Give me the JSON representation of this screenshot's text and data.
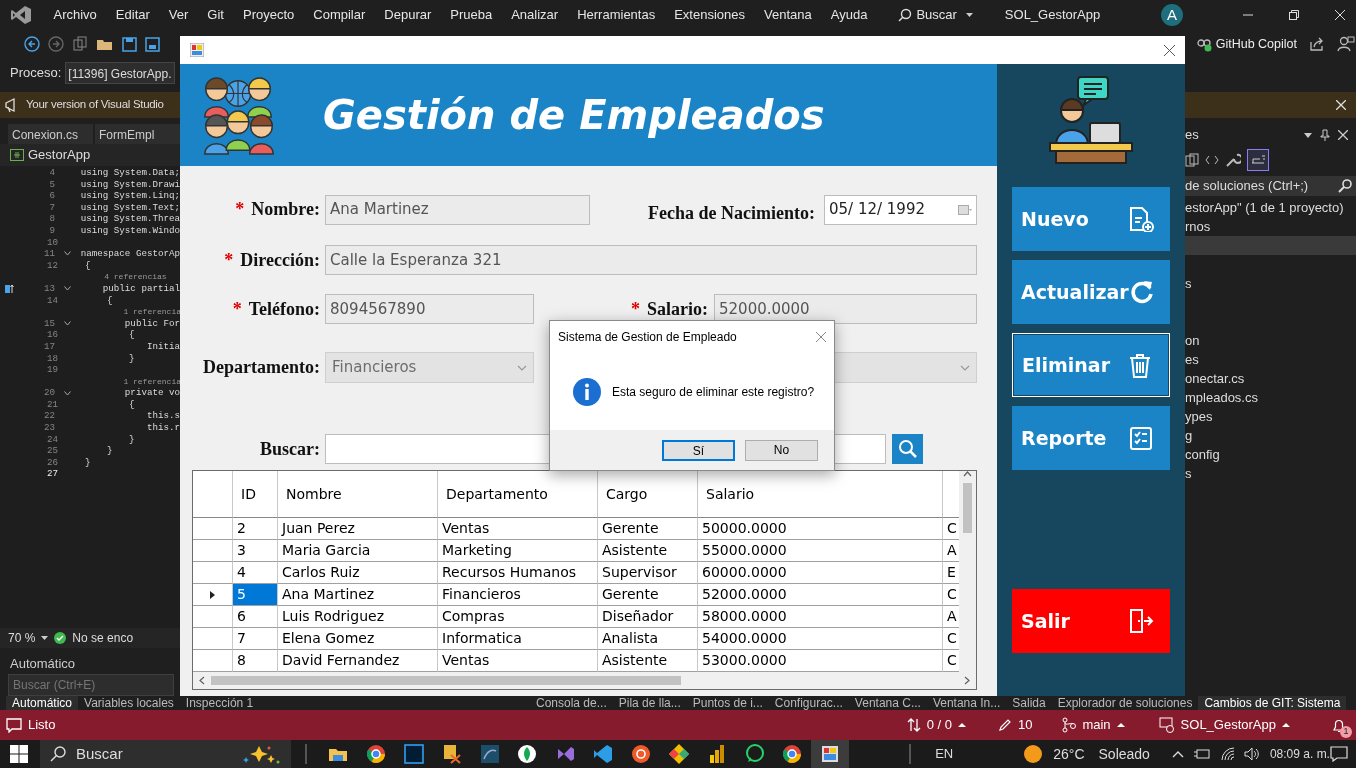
{
  "ide": {
    "menu": [
      "Archivo",
      "Editar",
      "Ver",
      "Git",
      "Proyecto",
      "Compilar",
      "Depurar",
      "Prueba",
      "Analizar",
      "Herramientas",
      "Extensiones",
      "Ventana",
      "Ayuda"
    ],
    "search": "Buscar",
    "solution_name": "SOL_GestorApp",
    "account_initial": "A",
    "copilot": "GitHub Copilot",
    "process_label": "Proceso:",
    "process_value": "[11396] GestorApp.",
    "notification": "Your version of Visual Studio",
    "editor_tabs": [
      "Conexion.cs",
      "FormEmpl"
    ],
    "project_dropdown": "GestorApp",
    "code_lines": [
      {
        "kind": "code",
        "number": "4",
        "text": "using System.Data;"
      },
      {
        "kind": "code",
        "number": "5",
        "text": "using System.Drawi"
      },
      {
        "kind": "code",
        "number": "6",
        "text": "using System.Linq;"
      },
      {
        "kind": "code",
        "number": "7",
        "text": "using System.Text;"
      },
      {
        "kind": "code",
        "number": "8",
        "text": "using System.Threa"
      },
      {
        "kind": "code",
        "number": "9",
        "text": "using System.Windo"
      },
      {
        "kind": "code",
        "number": "10"
      },
      {
        "kind": "code",
        "number": "11",
        "text": "namespace GestorAp",
        "foldable": true
      },
      {
        "kind": "code",
        "number": "12",
        "text": "{"
      },
      {
        "kind": "lens",
        "text": "    4 referencias"
      },
      {
        "kind": "code",
        "number": "13",
        "text": "    public partial",
        "foldable": true,
        "marker": true
      },
      {
        "kind": "code",
        "number": "14",
        "text": "    {"
      },
      {
        "kind": "lens",
        "text": "        1 referencia"
      },
      {
        "kind": "code",
        "number": "15",
        "text": "        public For",
        "foldable": true
      },
      {
        "kind": "code",
        "number": "16",
        "text": "        {"
      },
      {
        "kind": "code",
        "number": "17",
        "text": "            Initia"
      },
      {
        "kind": "code",
        "number": "18",
        "text": "        }"
      },
      {
        "kind": "code",
        "number": "19"
      },
      {
        "kind": "lens",
        "text": "        1 referencia"
      },
      {
        "kind": "code",
        "number": "20",
        "text": "        private vo",
        "foldable": true
      },
      {
        "kind": "code",
        "number": "21",
        "text": "        {"
      },
      {
        "kind": "code",
        "number": "22",
        "text": "            this.s"
      },
      {
        "kind": "code",
        "number": "23",
        "text": "            this.r"
      },
      {
        "kind": "code",
        "number": "24",
        "text": "        }"
      },
      {
        "kind": "code",
        "number": "25",
        "text": "    }"
      },
      {
        "kind": "code",
        "number": "26",
        "text": "}"
      },
      {
        "kind": "code",
        "number": "27",
        "current": true
      }
    ],
    "zoom": "70 %",
    "issues": "No se enco",
    "auto_panel": {
      "title": "Automático",
      "search_placeholder": "Buscar (Ctrl+E)"
    },
    "solution_explorer": {
      "title": "es",
      "search": "de soluciones (Ctrl+;)",
      "items": [
        {
          "text": "estorApp\"  (1 de 1 proyecto)",
          "selected": false
        },
        {
          "text": "rnos",
          "selected": false
        },
        {
          "selected": true
        },
        {
          "selected": false
        },
        {
          "text": "s",
          "selected": false
        },
        {
          "selected": false
        },
        {
          "selected": false
        },
        {
          "text": "on",
          "selected": false
        },
        {
          "text": "es",
          "selected": false
        },
        {
          "text": "onectar.cs",
          "selected": false
        },
        {
          "text": "mpleados.cs",
          "selected": false
        },
        {
          "text": "ypes",
          "selected": false
        },
        {
          "text": "g",
          "selected": false
        },
        {
          "text": "config",
          "selected": false
        },
        {
          "text": "s",
          "selected": false
        }
      ]
    },
    "bottom_tabs_left": [
      {
        "label": "Automático",
        "selected": true
      },
      {
        "label": "Variables locales",
        "selected": false
      },
      {
        "label": "Inspección 1",
        "selected": false
      }
    ],
    "bottom_tabs_right": [
      {
        "label": "Consola de...",
        "selected": false
      },
      {
        "label": "Pila de lla...",
        "selected": false
      },
      {
        "label": "Puntos de i...",
        "selected": false
      },
      {
        "label": "Configurac...",
        "selected": false
      },
      {
        "label": "Ventana C...",
        "selected": false
      },
      {
        "label": "Ventana In...",
        "selected": false
      },
      {
        "label": "Salida",
        "selected": false
      },
      {
        "label": "Explorador de soluciones",
        "selected": false
      },
      {
        "label": "Cambios de GIT: Sistema",
        "selected": true
      }
    ],
    "status_bar": {
      "message": "Listo",
      "sync": "0 / 0",
      "edits": "10",
      "branch": "main",
      "repo": "SOL_GestorApp",
      "notifications": "1"
    }
  },
  "taskbar": {
    "search": "Buscar",
    "language": "EN",
    "temperature": "26°C",
    "weather": "Soleado",
    "time": "08:09 a. m."
  },
  "form": {
    "header_title": "Gestión de Empleados",
    "rows": [
      [
        {
          "kind": "text",
          "required_mark": "*",
          "label": "Nombre:",
          "value": "Ana Martinez",
          "read_only": true
        },
        {
          "kind": "date",
          "label": "Fecha de Nacimiento:",
          "value": "05/ 12/ 1992"
        }
      ],
      [
        {
          "kind": "text",
          "required_mark": "*",
          "label": "Dirección:",
          "value": "Calle la Esperanza 321",
          "read_only": true
        }
      ],
      [
        {
          "kind": "text",
          "required_mark": "*",
          "label": "Teléfono:",
          "value": "8094567890",
          "read_only": true
        },
        {
          "kind": "text",
          "required_mark": "*",
          "label": "Salario:",
          "value": "52000.0000",
          "read_only": true
        }
      ],
      [
        {
          "kind": "combo",
          "label": "Departamento:",
          "value": "Financieros",
          "disabled": true
        },
        {
          "kind": "combo",
          "disabled": true
        }
      ]
    ],
    "search": {
      "label": "Buscar:"
    },
    "grid": {
      "columns": [
        "ID",
        "Nombre",
        "Departamento",
        "Cargo",
        "Salario"
      ],
      "rows": [
        {
          "selected": false,
          "cells": [
            "2",
            "Juan Perez",
            "Ventas",
            "Gerente",
            "50000.0000",
            "C"
          ]
        },
        {
          "selected": false,
          "cells": [
            "3",
            "Maria Garcia",
            "Marketing",
            "Asistente",
            "55000.0000",
            "A"
          ]
        },
        {
          "selected": false,
          "cells": [
            "4",
            "Carlos Ruiz",
            "Recursos Humanos",
            "Supervisor",
            "60000.0000",
            "E"
          ]
        },
        {
          "selected": true,
          "cells": [
            "5",
            "Ana Martinez",
            "Financieros",
            "Gerente",
            "52000.0000",
            "C"
          ]
        },
        {
          "selected": false,
          "cells": [
            "6",
            "Luis Rodriguez",
            "Compras",
            "Diseñador",
            "58000.0000",
            "A"
          ]
        },
        {
          "selected": false,
          "cells": [
            "7",
            "Elena Gomez",
            "Informatica",
            "Analista",
            "54000.0000",
            "C"
          ]
        },
        {
          "selected": false,
          "cells": [
            "8",
            "David Fernandez",
            "Ventas",
            "Asistente",
            "53000.0000",
            "C"
          ]
        }
      ]
    },
    "side_buttons": [
      {
        "label": "Nuevo",
        "kind": "new",
        "focused": false
      },
      {
        "label": "Actualizar",
        "kind": "refresh",
        "focused": false
      },
      {
        "label": "Eliminar",
        "kind": "delete",
        "focused": true
      },
      {
        "label": "Reporte",
        "kind": "report",
        "focused": false
      },
      {
        "label": "Salir",
        "kind": "exit",
        "focused": false
      }
    ]
  },
  "dialog": {
    "title": "Sistema de Gestion de Empleado",
    "message": "Esta seguro de eliminar este registro?",
    "buttons": [
      {
        "label": "Sí",
        "default": true
      },
      {
        "label": "No",
        "default": false
      }
    ]
  }
}
